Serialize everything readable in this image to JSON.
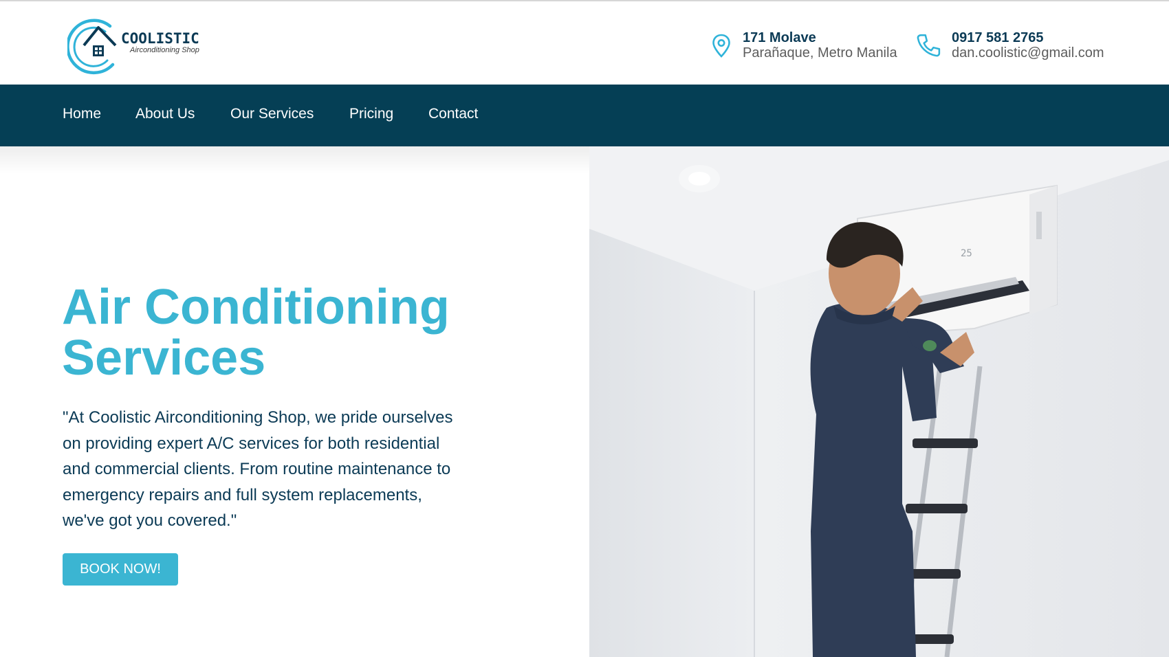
{
  "brand": {
    "name": "COOLISTIC",
    "tagline": "Airconditioning Shop"
  },
  "contact": {
    "address_line1": "171 Molave",
    "address_line2": "Parañaque, Metro Manila",
    "phone": "0917 581 2765",
    "email": "dan.coolistic@gmail.com"
  },
  "nav": {
    "items": [
      "Home",
      "About Us",
      "Our Services",
      "Pricing",
      "Contact"
    ]
  },
  "hero": {
    "title_line1": "Air Conditioning",
    "title_line2": "Services",
    "description": "\"At Coolistic Airconditioning Shop, we pride ourselves on providing expert A/C services for both residential and commercial clients. From routine maintenance to emergency repairs and full system replacements, we've got you covered.\"",
    "cta_label": "BOOK NOW!",
    "ac_display": "25"
  },
  "colors": {
    "navy": "#053f55",
    "accent": "#3bb5d2",
    "text_dark": "#0b3a55"
  }
}
